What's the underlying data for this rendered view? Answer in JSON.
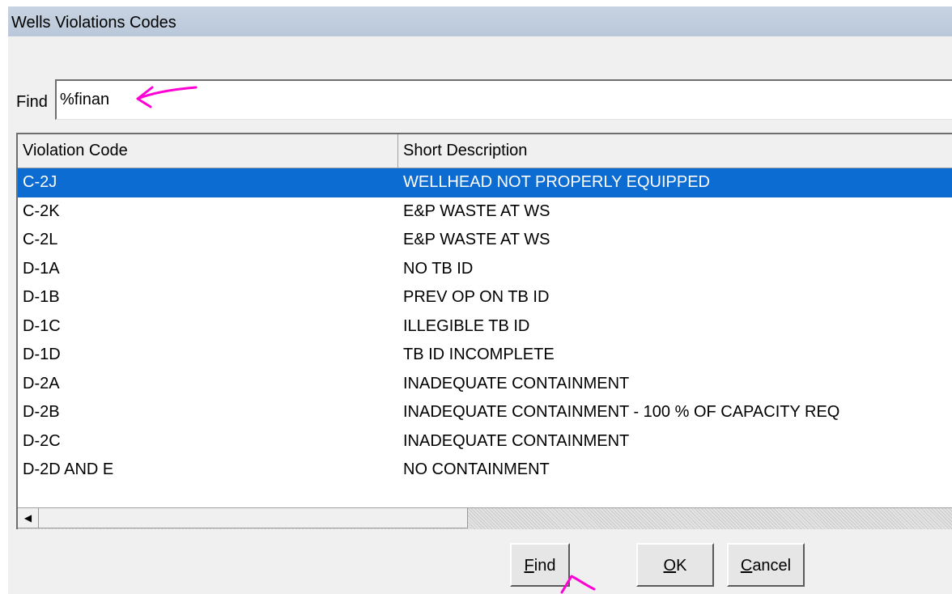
{
  "window": {
    "title": "Wells Violations Codes"
  },
  "find": {
    "label": "Find",
    "value": "%finan"
  },
  "grid": {
    "columns": [
      "Violation Code",
      "Short Description"
    ],
    "selected_index": 0,
    "rows": [
      {
        "code": "C-2J",
        "desc": "WELLHEAD NOT PROPERLY EQUIPPED"
      },
      {
        "code": "C-2K",
        "desc": "E&P WASTE AT WS"
      },
      {
        "code": "C-2L",
        "desc": "E&P WASTE AT WS"
      },
      {
        "code": "D-1A",
        "desc": "NO TB ID"
      },
      {
        "code": "D-1B",
        "desc": "PREV OP ON TB ID"
      },
      {
        "code": "D-1C",
        "desc": "ILLEGIBLE TB ID"
      },
      {
        "code": "D-1D",
        "desc": "TB ID INCOMPLETE"
      },
      {
        "code": "D-2A",
        "desc": "INADEQUATE CONTAINMENT"
      },
      {
        "code": "D-2B",
        "desc": "INADEQUATE CONTAINMENT - 100 % OF CAPACITY REQ"
      },
      {
        "code": "D-2C",
        "desc": "INADEQUATE CONTAINMENT"
      },
      {
        "code": "D-2D AND E",
        "desc": "NO CONTAINMENT"
      }
    ]
  },
  "buttons": {
    "find": {
      "mnemonic": "F",
      "rest": "ind"
    },
    "ok": {
      "mnemonic": "O",
      "rest": "K"
    },
    "cancel": {
      "mnemonic": "C",
      "rest": "ancel"
    }
  },
  "colors": {
    "selection": "#0c6cd1",
    "annotation": "#ff00d4",
    "titlebar": "#c1cedf"
  },
  "icons": {
    "scroll_left": "scroll-left-arrow-icon",
    "annotation": "arrow-annotation-icon"
  }
}
